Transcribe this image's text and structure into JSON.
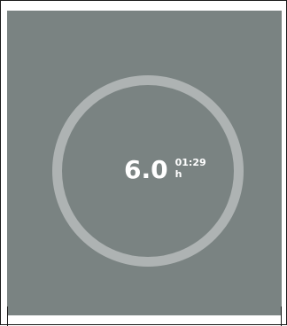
{
  "readout": {
    "value": "6.0",
    "unit": "h",
    "time": "01:29"
  },
  "ring": {
    "color": "#aeb3b3"
  },
  "panel": {
    "background": "#7a8382"
  }
}
